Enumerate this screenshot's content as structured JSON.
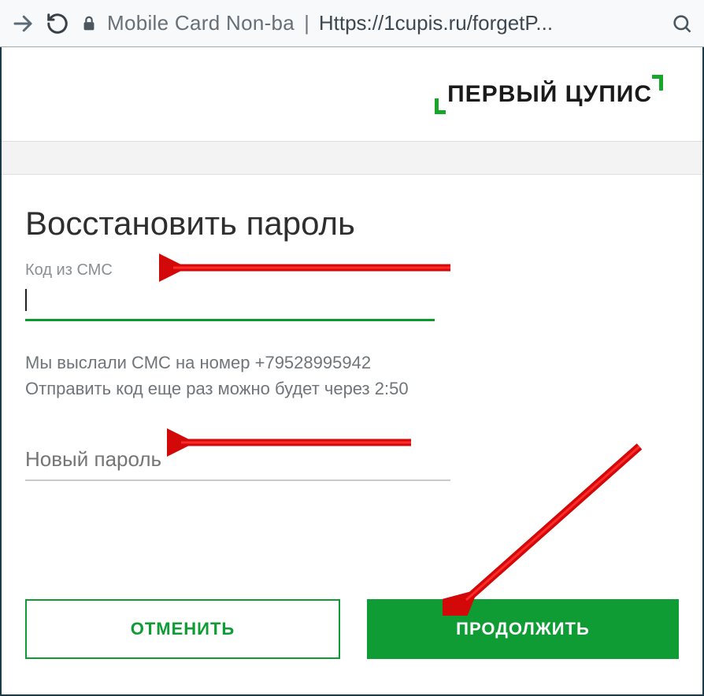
{
  "browser": {
    "page_title": "Mobile Card Non-ba",
    "url": "Https://1cupis.ru/forgetP..."
  },
  "brand": "ПЕРВЫЙ ЦУПИС",
  "heading": "Восстановить пароль",
  "sms_label": "Код из СМС",
  "sms_value": "",
  "info_line1": "Мы выслали СМС на номер +79528995942",
  "info_line2": "Отправить код еще раз можно будет через 2:50",
  "password_placeholder": "Новый пароль",
  "buttons": {
    "cancel": "ОТМЕНИТЬ",
    "continue": "ПРОДОЛЖИТЬ"
  }
}
